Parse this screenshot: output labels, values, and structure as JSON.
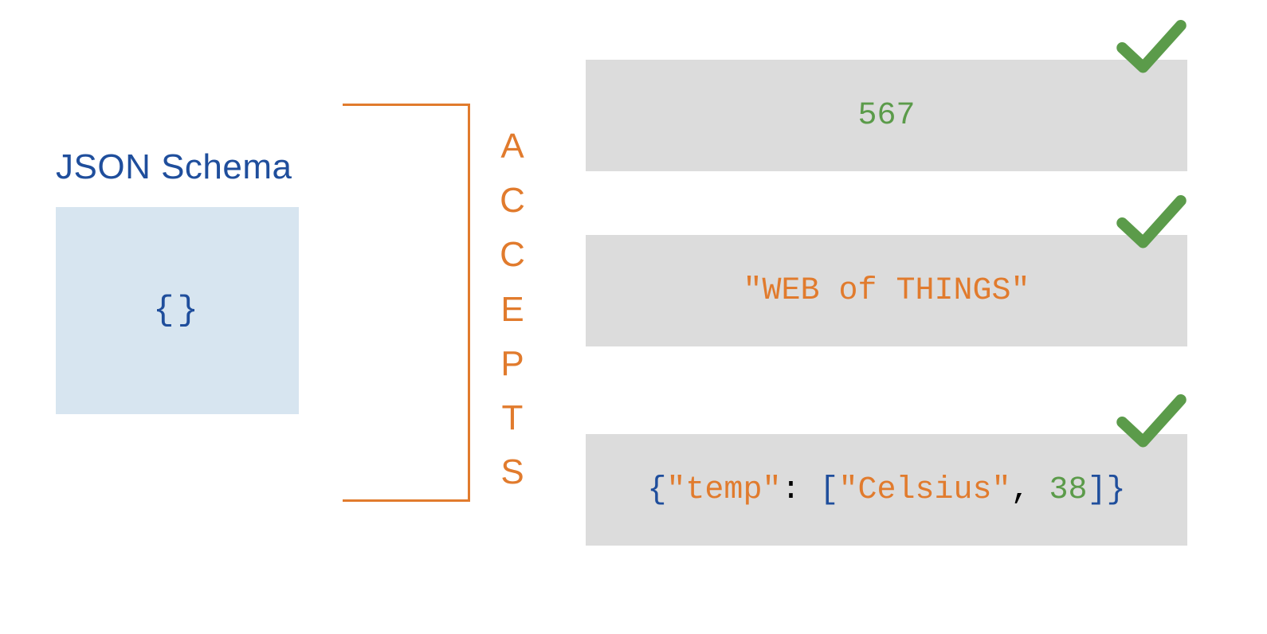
{
  "schema": {
    "title": "JSON Schema",
    "content": "{}"
  },
  "relation_label": "ACCEPTS",
  "examples": [
    {
      "kind": "number",
      "display": "567",
      "accepted": true
    },
    {
      "kind": "string",
      "display": "\"WEB of THINGS\"",
      "accepted": true
    },
    {
      "kind": "object",
      "tokens": {
        "open": "{",
        "key": "\"temp\"",
        "colon": ": ",
        "lb": "[",
        "str": "\"Celsius\"",
        "comma": ", ",
        "num": "38",
        "rb": "]",
        "close": "}"
      },
      "accepted": true
    }
  ],
  "colors": {
    "schema_blue": "#1f4e9c",
    "accent_orange": "#e17b2d",
    "ok_green": "#5b9b4a",
    "box_grey": "#dcdcdc",
    "schema_bg": "#d7e5f0"
  }
}
